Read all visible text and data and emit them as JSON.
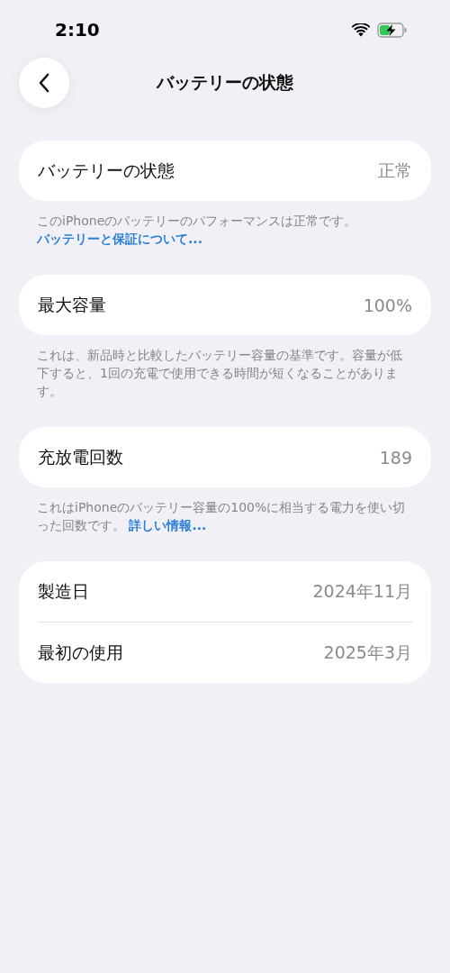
{
  "status_bar": {
    "time": "2:10"
  },
  "nav": {
    "title": "バッテリーの状態"
  },
  "sections": [
    {
      "rows": [
        {
          "label": "バッテリーの状態",
          "value": "正常"
        }
      ],
      "footer": {
        "text": "このiPhoneのバッテリーのパフォーマンスは正常です。",
        "link": "バッテリーと保証について..."
      }
    },
    {
      "rows": [
        {
          "label": "最大容量",
          "value": "100%"
        }
      ],
      "footer": {
        "text": "これは、新品時と比較したバッテリー容量の基準です。容量が低下すると、1回の充電で使用できる時間が短くなることがあります。"
      }
    },
    {
      "rows": [
        {
          "label": "充放電回数",
          "value": "189"
        }
      ],
      "footer": {
        "text": "これはiPhoneのバッテリー容量の100%に相当する電力を使い切った回数です。",
        "link": "詳しい情報..."
      }
    },
    {
      "rows": [
        {
          "label": "製造日",
          "value": "2024年11月"
        },
        {
          "label": "最初の使用",
          "value": "2025年3月"
        }
      ]
    }
  ]
}
